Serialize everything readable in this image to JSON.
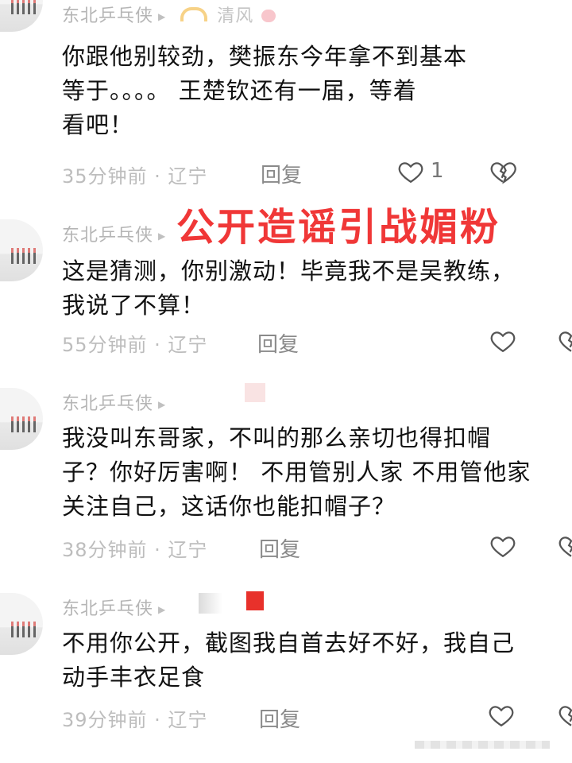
{
  "overlay_caption": "公开造谣引战媚粉",
  "comments": [
    {
      "username": "东北乒乓侠",
      "badge": "清风",
      "text": "你跟他别较劲，樊振东今年拿不到基本\n等于。。。。 王楚钦还有一届，等着\n看吧！",
      "time_location": "35分钟前 · 辽宁",
      "reply": "回复",
      "likes": "1"
    },
    {
      "username": "东北乒乓侠",
      "text": "这是猜测，你别激动！毕竟我不是吴教练，\n我说了不算！",
      "time_location": "55分钟前 · 辽宁",
      "reply": "回复"
    },
    {
      "username": "东北乒乓侠",
      "text": "我没叫东哥家，不叫的那么亲切也得扣帽\n子？你好厉害啊！ 不用管别人家 不用管他家\n关注自己，这话你也能扣帽子？",
      "time_location": "38分钟前 · 辽宁",
      "reply": "回复"
    },
    {
      "username": "东北乒乓侠",
      "text": "不用你公开，截图我自首去好不好，我自己\n动手丰衣足食",
      "time_location": "39分钟前 · 辽宁",
      "reply": "回复"
    }
  ],
  "icons": {
    "like": "heart-outline-icon",
    "dislike": "broken-heart-icon",
    "play": "play-triangle-icon"
  },
  "colors": {
    "overlay_red": "#f03737",
    "meta_gray": "#bdbdbd",
    "username_gray": "#b5b5b5"
  }
}
